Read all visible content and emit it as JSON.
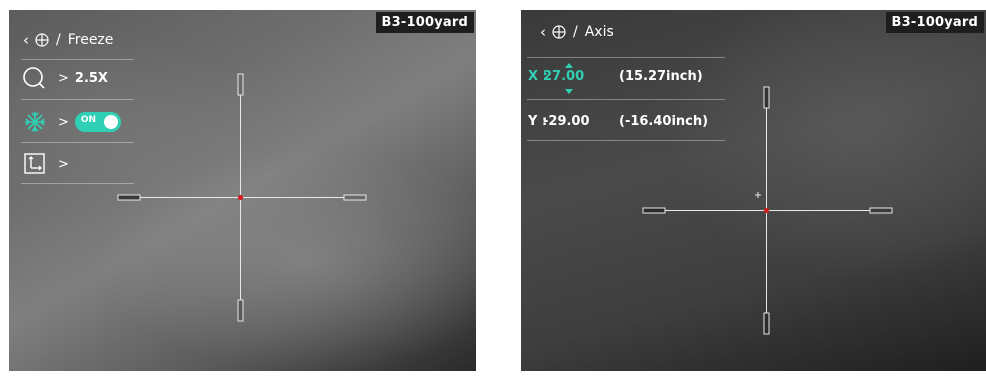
{
  "left": {
    "badge": "B3-100yard",
    "breadcrumb": {
      "back_icon": "chevron-left-icon",
      "target_icon": "crosshair-circle-icon",
      "separator": "/",
      "label": "Freeze"
    },
    "menu": [
      {
        "icon": "zoom-circle-icon",
        "chevron": ">",
        "value": "2.5X"
      },
      {
        "icon": "snowflake-icon",
        "chevron": ">",
        "toggle_text": "ON",
        "toggle_state": "on"
      },
      {
        "icon": "axis-icon",
        "chevron": ">"
      }
    ]
  },
  "right": {
    "badge": "B3-100yard",
    "breadcrumb": {
      "back_icon": "chevron-left-icon",
      "target_icon": "crosshair-circle-icon",
      "separator": "/",
      "label": "Axis"
    },
    "x_label": "X :",
    "x_value": "27.00",
    "x_inch": "(15.27inch)",
    "y_label": "Y :",
    "y_value": "-29.00",
    "y_inch": "(-16.40inch)"
  },
  "colors": {
    "accent": "#2fd0b4",
    "reticle_center": "#d02020",
    "badge_bg": "#1e1e1e"
  }
}
